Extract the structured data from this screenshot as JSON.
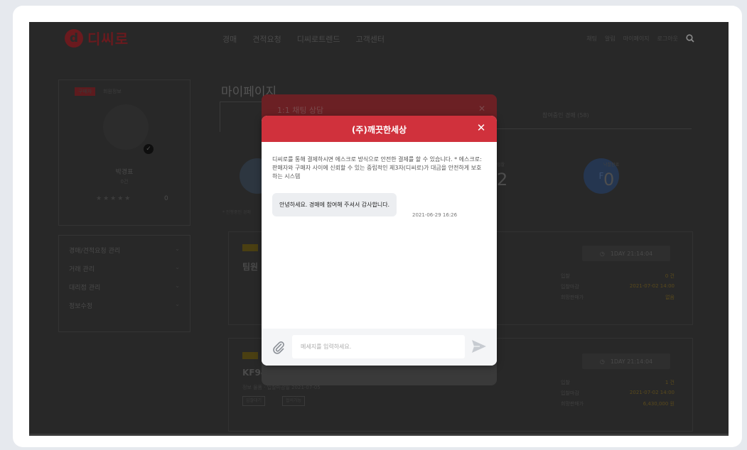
{
  "header": {
    "logo_mark": "d",
    "logo_text": "디씨로",
    "nav": [
      "경매",
      "견적요청",
      "디씨로트렌드",
      "고객센터"
    ],
    "util": [
      "채팅",
      "알림",
      "마이페이지",
      "로그아웃"
    ]
  },
  "sidebar": {
    "badge": "구매자",
    "badge_sub": "회원정보",
    "name": "박경표",
    "level": "0건",
    "stars": "★★★★★",
    "rating": "0",
    "menu": [
      {
        "label": "경매/견적요청 관리"
      },
      {
        "label": "거래 관리"
      },
      {
        "label": "대리점 관리"
      },
      {
        "label": "정보수정"
      }
    ]
  },
  "main": {
    "title": "마이페이지",
    "tab_right": "참여중인 경매 (58)",
    "stats": [
      {
        "label": "입찰",
        "value": "2"
      },
      {
        "label": "낙찰완료",
        "value": "0"
      }
    ],
    "note": "* 진행중인 경매",
    "items": [
      {
        "title": "팀원",
        "timer": "1DAY 21:14:04",
        "rows": [
          {
            "k": "입찰",
            "v": "0 건"
          },
          {
            "k": "입찰마감",
            "v": "2021-07-02 14:00"
          },
          {
            "k": "희망판매가",
            "v": "없음"
          }
        ]
      },
      {
        "title": "KF94",
        "meta": "정보 물품 · 입찰마감일 2021-07-05",
        "chips": [
          "입찰대기",
          "협의가능"
        ],
        "timer": "1DAY 21:14:04",
        "rows": [
          {
            "k": "입찰",
            "v": "1 건"
          },
          {
            "k": "입찰마감",
            "v": "2021-07-02 14:00"
          },
          {
            "k": "희망판매가",
            "v": "6,430,000 원"
          }
        ]
      }
    ]
  },
  "ghost_modal": {
    "title": "1:1 채팅 상담"
  },
  "chat_modal": {
    "title": "(주)깨끗한세상",
    "notice": "디씨로를 통해 결제하시면 에스크로 방식으로 안전한 결제를 할 수 있습니다. * 에스크로: 판매자와 구매자 사이에 신뢰할 수 있는 중립적인 제3자(디씨로)가 대금을 안전하게 보호하는 시스템",
    "message": "안녕하세요. 경매에 참여해 주셔서 감사합니다.",
    "message_time": "2021-06-29 16:26",
    "input_placeholder": "메세지를 입력하세요.",
    "colors": {
      "accent": "#d0313c"
    }
  }
}
